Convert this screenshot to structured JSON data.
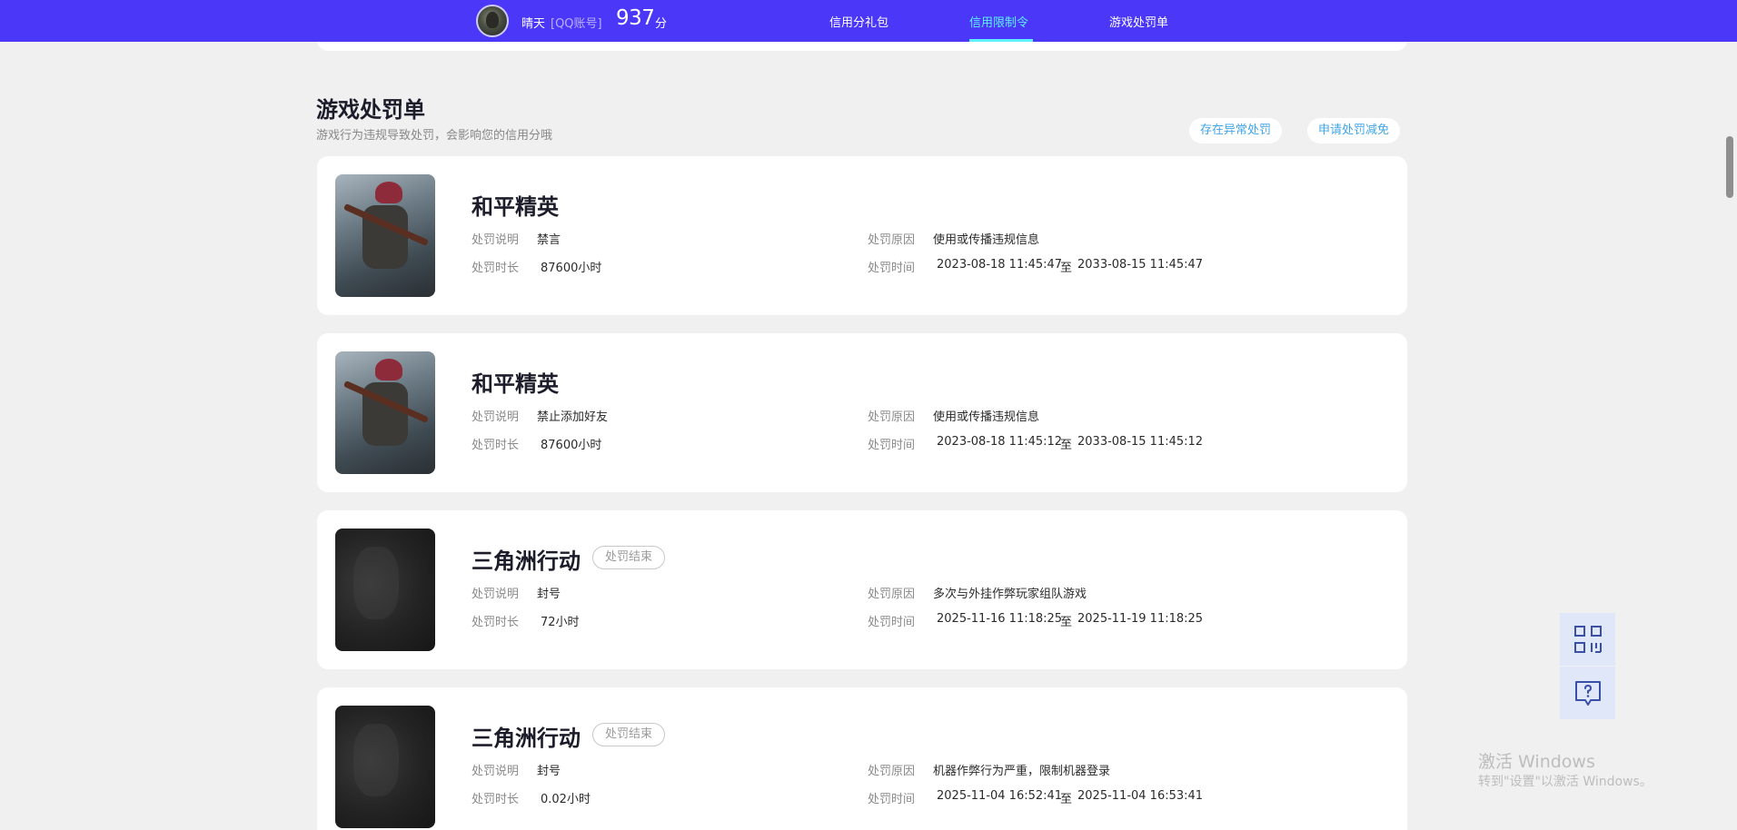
{
  "topbar": {
    "user_name": "晴天",
    "account_type": "[QQ账号]",
    "score": "937",
    "score_unit": "分",
    "nav": [
      {
        "label": "信用分礼包",
        "active": false
      },
      {
        "label": "信用限制令",
        "active": true
      },
      {
        "label": "游戏处罚单",
        "active": false
      }
    ],
    "accent_color": "#4b37f7",
    "active_tab_color": "#5ef0ff"
  },
  "section": {
    "title": "游戏处罚单",
    "subtitle": "游戏行为违规导致处罚，会影响您的信用分哦",
    "buttons": {
      "abnormal": "存在异常处罚",
      "appeal": "申请处罚减免"
    }
  },
  "labels": {
    "description": "处罚说明",
    "duration": "处罚时长",
    "reason": "处罚原因",
    "time": "处罚时间",
    "time_separator": "至"
  },
  "penalties": [
    {
      "game": "和平精英",
      "thumbnail_icon": "peace-elite-thumbnail",
      "status": "",
      "description": "禁言",
      "duration": "87600小时",
      "reason": "使用或传播违规信息",
      "start": "2023-08-18 11:45:47",
      "end": "2033-08-15 11:45:47"
    },
    {
      "game": "和平精英",
      "thumbnail_icon": "peace-elite-thumbnail",
      "status": "",
      "description": "禁止添加好友",
      "duration": "87600小时",
      "reason": "使用或传播违规信息",
      "start": "2023-08-18 11:45:12",
      "end": "2033-08-15 11:45:12"
    },
    {
      "game": "三角洲行动",
      "thumbnail_icon": "delta-force-thumbnail",
      "status": "处罚结束",
      "description": "封号",
      "duration": "72小时",
      "reason": "多次与外挂作弊玩家组队游戏",
      "start": "2025-11-16 11:18:25",
      "end": "2025-11-19 11:18:25"
    },
    {
      "game": "三角洲行动",
      "thumbnail_icon": "delta-force-thumbnail",
      "status": "处罚结束",
      "description": "封号",
      "duration": "0.02小时",
      "reason": "机器作弊行为严重，限制机器登录",
      "start": "2025-11-04 16:52:41",
      "end": "2025-11-04 16:53:41"
    }
  ],
  "float_tools": [
    "qr-code-icon",
    "help-chat-icon"
  ],
  "watermark": {
    "title": "激活 Windows",
    "subtitle": "转到\"设置\"以激活 Windows。"
  }
}
